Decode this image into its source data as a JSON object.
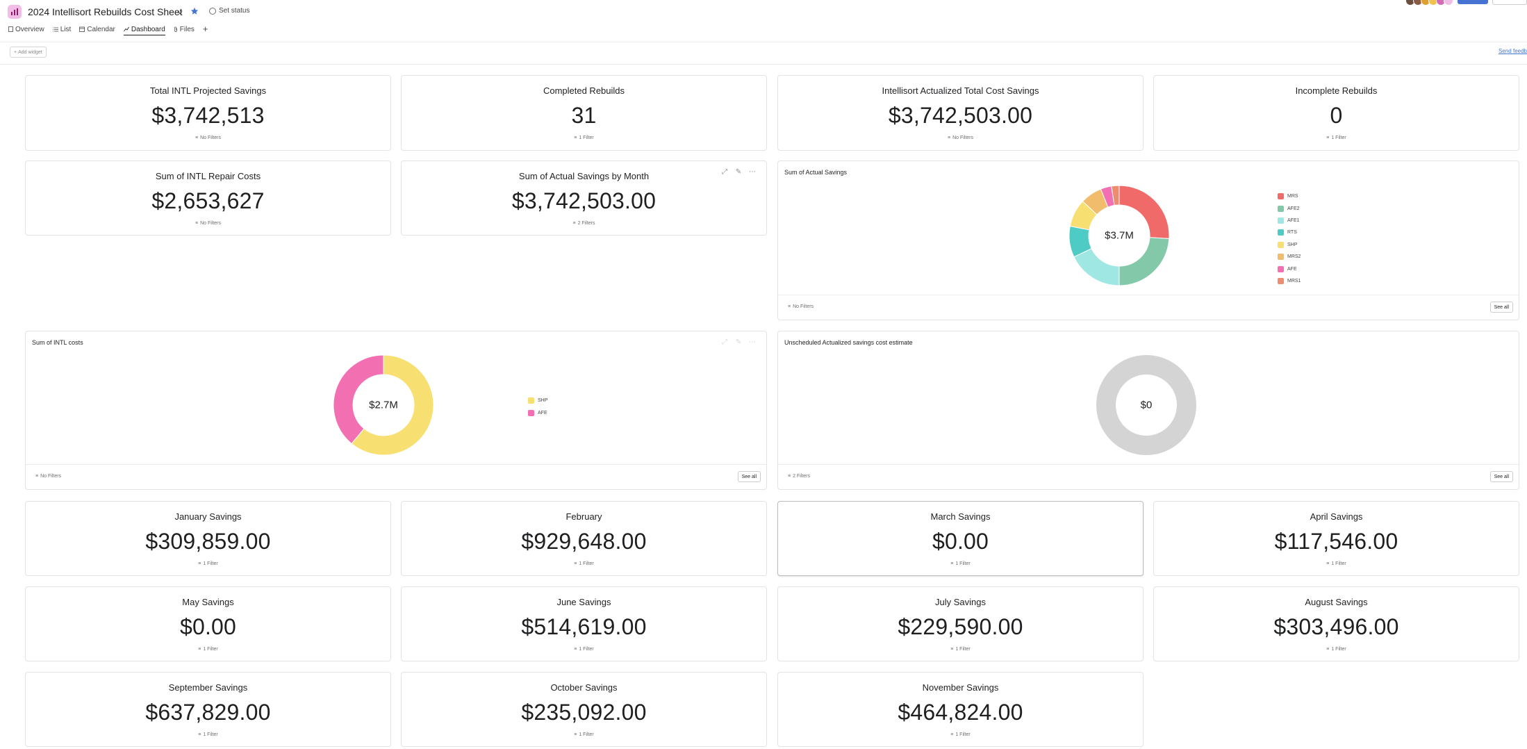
{
  "header": {
    "title": "2024 Intellisort Rebuilds Cost Sheet",
    "set_status": "Set status",
    "tabs": [
      {
        "label": "Overview"
      },
      {
        "label": "List"
      },
      {
        "label": "Calendar"
      },
      {
        "label": "Dashboard",
        "active": true
      },
      {
        "label": "Files"
      }
    ],
    "add_tab": "+",
    "avatar_colors": [
      "#6b4e3d",
      "#8a5a44",
      "#e0a030",
      "#f2c14e",
      "#d36bb5",
      "#f1bde6"
    ]
  },
  "toolbar": {
    "add_widget": "Add widget",
    "send_feedback": "Send feedb"
  },
  "metrics": [
    {
      "title": "Total INTL Projected Savings",
      "value": "$3,742,513",
      "filter": "No Filters"
    },
    {
      "title": "Completed Rebuilds",
      "value": "31",
      "filter": "1 Filter"
    },
    {
      "title": "Intellisort Actualized Total Cost Savings",
      "value": "$3,742,503.00",
      "filter": "No Filters"
    },
    {
      "title": "Incomplete Rebuilds",
      "value": "0",
      "filter": "1 Filter"
    },
    {
      "title": "Sum of INTL Repair Costs",
      "value": "$2,653,627",
      "filter": "No Filters"
    },
    {
      "title": "Sum of Actual Savings by Month",
      "value": "$3,742,503.00",
      "filter": "2 Filters"
    }
  ],
  "monthly": [
    {
      "title": "January Savings",
      "value": "$309,859.00",
      "filter": "1 Filter"
    },
    {
      "title": "February",
      "value": "$929,648.00",
      "filter": "1 Filter"
    },
    {
      "title": "March Savings",
      "value": "$0.00",
      "filter": "1 Filter"
    },
    {
      "title": "April Savings",
      "value": "$117,546.00",
      "filter": "1 Filter"
    },
    {
      "title": "May Savings",
      "value": "$0.00",
      "filter": "1 Filter"
    },
    {
      "title": "June Savings",
      "value": "$514,619.00",
      "filter": "1 Filter"
    },
    {
      "title": "July Savings",
      "value": "$229,590.00",
      "filter": "1 Filter"
    },
    {
      "title": "August Savings",
      "value": "$303,496.00",
      "filter": "1 Filter"
    },
    {
      "title": "September Savings",
      "value": "$637,829.00",
      "filter": "1 Filter"
    },
    {
      "title": "October Savings",
      "value": "$235,092.00",
      "filter": "1 Filter"
    },
    {
      "title": "November Savings",
      "value": "$464,824.00",
      "filter": "1 Filter"
    }
  ],
  "chart_data": [
    {
      "type": "pie",
      "title": "Sum of Actual Savings",
      "center_label": "$3.7M",
      "filter": "No Filters",
      "see_all": "See all",
      "categories": [
        "MRS",
        "AFE2",
        "AFE1",
        "RTS",
        "SHP",
        "MRS2",
        "AFE",
        "MRS1"
      ],
      "values": [
        0.26,
        0.24,
        0.18,
        0.1,
        0.09,
        0.07,
        0.035,
        0.025
      ],
      "colors": [
        "#f06a6a",
        "#83c9a9",
        "#9ee7e3",
        "#4ecbc4",
        "#f8df72",
        "#f1bd6c",
        "#f26fb2",
        "#ec8d71"
      ]
    },
    {
      "type": "pie",
      "title": "Sum of INTL costs",
      "center_label": "$2.7M",
      "filter": "No Filters",
      "see_all": "See all",
      "categories": [
        "SHP",
        "AFE"
      ],
      "values": [
        0.61,
        0.39
      ],
      "colors": [
        "#f8df72",
        "#f26fb2"
      ]
    },
    {
      "type": "pie",
      "title": "Unscheduled Actualized savings cost estimate",
      "center_label": "$0",
      "filter": "2 Filters",
      "see_all": "See all",
      "categories": [],
      "values": [],
      "colors": [
        "#d4d4d4"
      ]
    }
  ]
}
